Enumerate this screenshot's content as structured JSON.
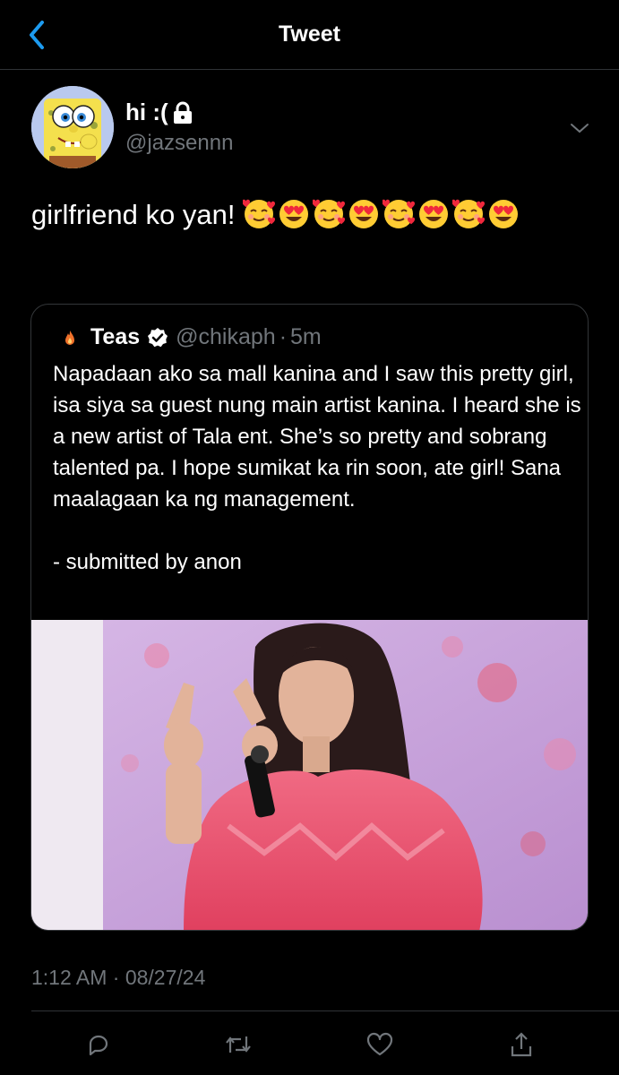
{
  "header": {
    "title": "Tweet"
  },
  "tweet": {
    "display_name": "hi :(",
    "handle": "@jazsennn",
    "text": "girlfriend ko yan!",
    "timestamp": "1:12 AM · 08/27/24"
  },
  "quote": {
    "name": "Teas",
    "handle": "@chikaph",
    "dot": "·",
    "time": "5m",
    "text": "Napadaan ako sa mall kanina and I saw this pretty girl, isa siya sa guest nung main artist kanina. I heard she is a new artist of Tala ent. She’s so pretty and sobrang talented pa. I hope sumikat ka rin soon, ate girl! Sana maalagaan ka ng management.\n\n- submitted by anon"
  },
  "icons": {
    "back": "chevron-left-icon",
    "lock": "lock-icon",
    "caret": "chevron-down-icon",
    "verified": "verified-badge-icon",
    "reply": "reply-icon",
    "retweet": "retweet-icon",
    "like": "heart-icon",
    "share": "share-icon"
  },
  "colors": {
    "accent": "#1d9bf0",
    "muted": "#71767b",
    "background": "#000000"
  }
}
